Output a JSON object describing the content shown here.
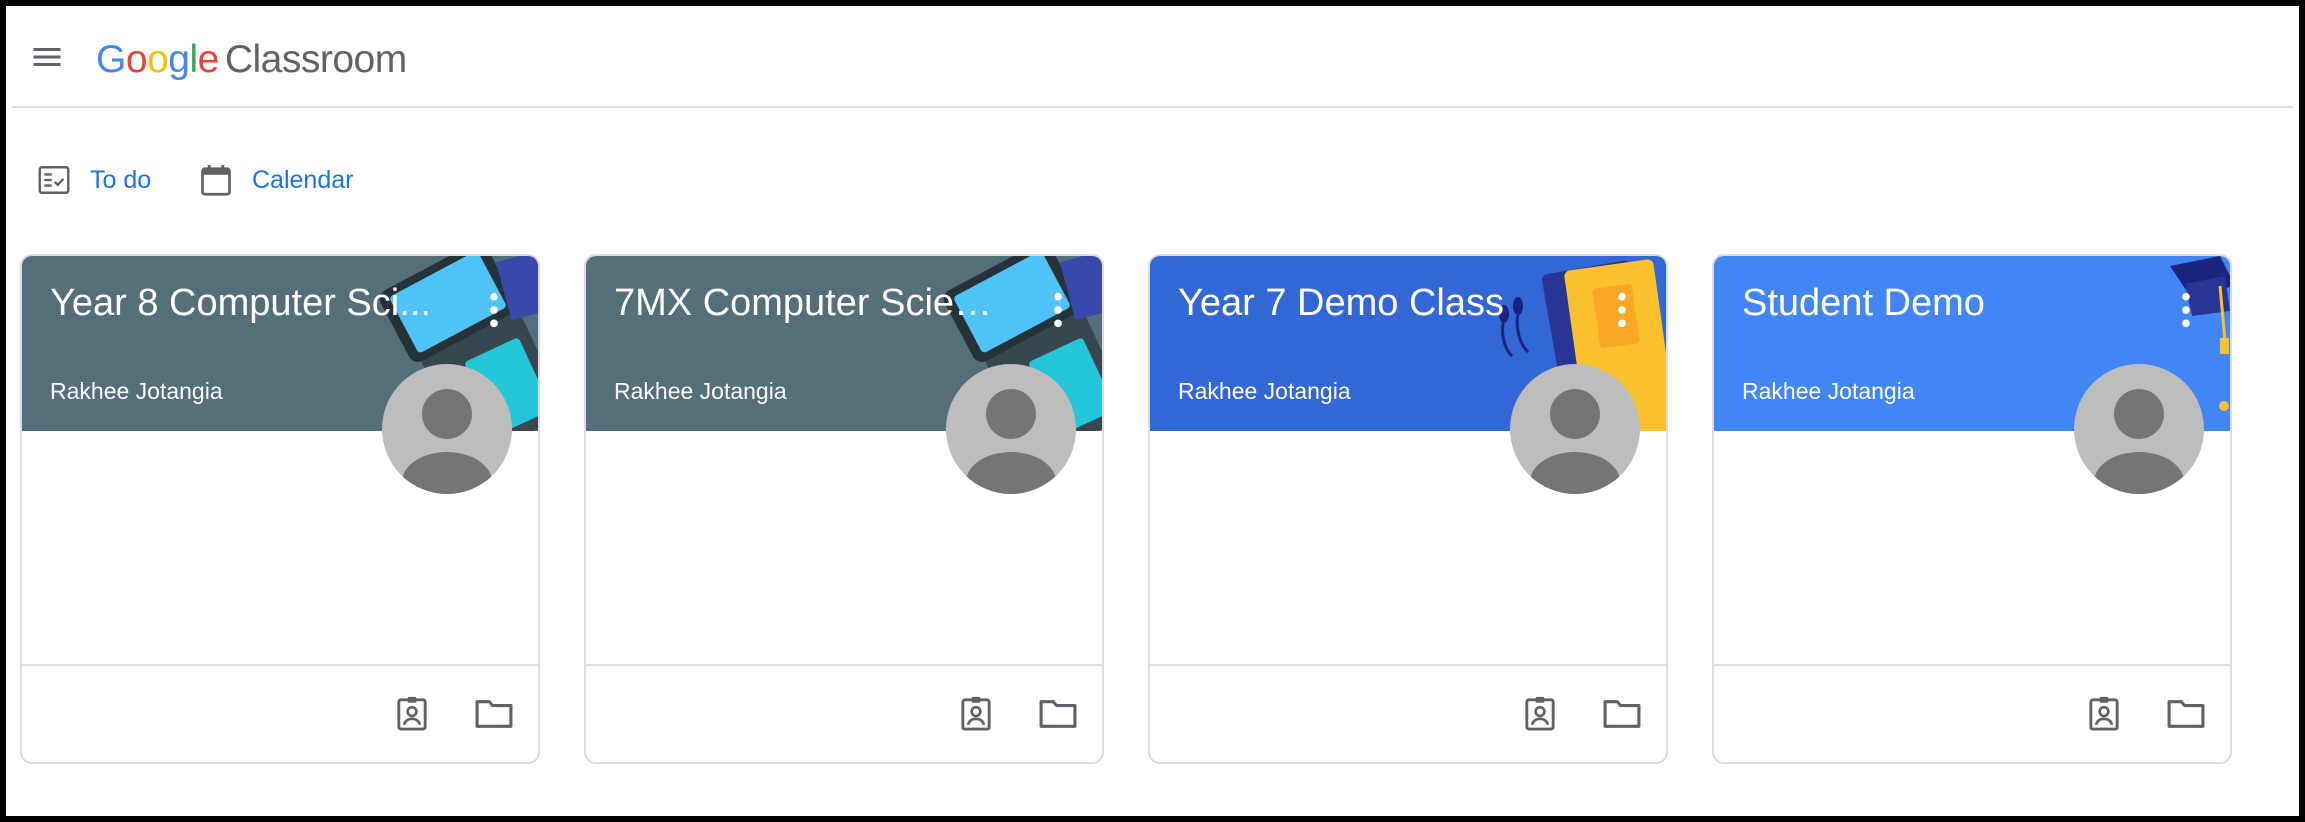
{
  "app": {
    "brand": [
      "G",
      "o",
      "o",
      "g",
      "l",
      "e"
    ],
    "product": "Classroom"
  },
  "nav": {
    "todo_label": "To do",
    "calendar_label": "Calendar",
    "link_color": "#1a73e8"
  },
  "icons": {
    "menu": "hamburger-menu-icon",
    "todo": "todo-checklist-icon",
    "calendar": "calendar-icon",
    "more": "more-vert-icon",
    "work": "assignment-ind-icon",
    "folder": "folder-icon"
  },
  "classes": [
    {
      "title": "Year 8 Computer Sci...",
      "owner": "Rakhee Jotangia",
      "color": "#546e7a",
      "theme": "tablet"
    },
    {
      "title": "7MX Computer Scien...",
      "owner": "Rakhee Jotangia",
      "color": "#546e7a",
      "theme": "tablet"
    },
    {
      "title": "Year 7 Demo Class",
      "owner": "Rakhee Jotangia",
      "color": "#3367d6",
      "theme": "notebook"
    },
    {
      "title": "Student Demo",
      "owner": "Rakhee Jotangia",
      "color": "#4285f4",
      "theme": "graduation"
    }
  ]
}
